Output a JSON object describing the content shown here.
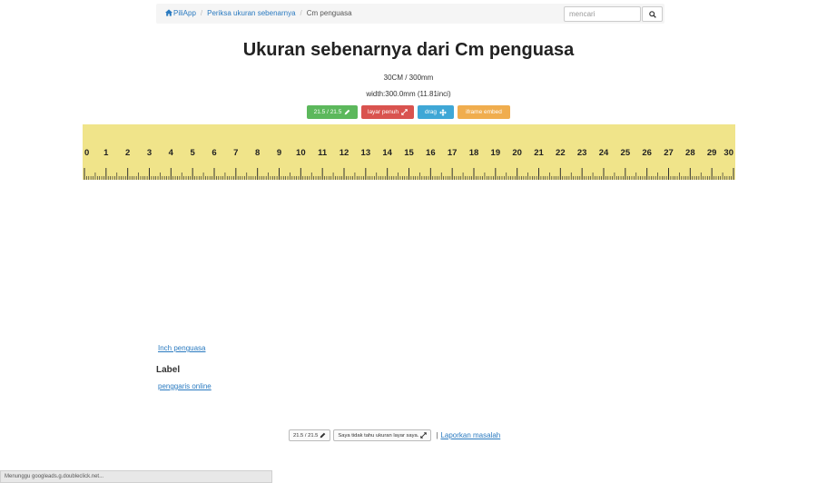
{
  "nav": {
    "home": "PiliApp",
    "crumb2": "Periksa ukuran sebenarnya",
    "crumb3": "Cm penguasa",
    "search_placeholder": "mencari"
  },
  "header": {
    "title": "Ukuran sebenarnya dari Cm penguasa",
    "size_line": "30CM / 300mm",
    "width_line": "width:300.0mm (11.81inci)"
  },
  "buttons": {
    "scale": "21.5 / 21.5",
    "fullscreen": "layar penuh",
    "drag": "drag",
    "iframe": "iframe embed"
  },
  "ruler": {
    "unit": "cm",
    "max": 30
  },
  "links": {
    "inch_ruler": "Inch penguasa",
    "label_heading": "Label",
    "online_ruler": "penggaris online"
  },
  "footer": {
    "scale_btn": "21.5 / 21.5",
    "unknown_size_btn": "Saya tidak tahu ukuran layar saya.",
    "pipe": "|",
    "report": "Laporkan masalah"
  },
  "status": {
    "text": "Menunggu googleads.g.doubleclick.net..."
  },
  "colors": {
    "ruler_bg": "#f0e48a",
    "link": "#2a7ac0",
    "green": "#5cb85c",
    "red": "#d9534f",
    "blue": "#3fa7d6",
    "orange": "#f0ad4e"
  }
}
